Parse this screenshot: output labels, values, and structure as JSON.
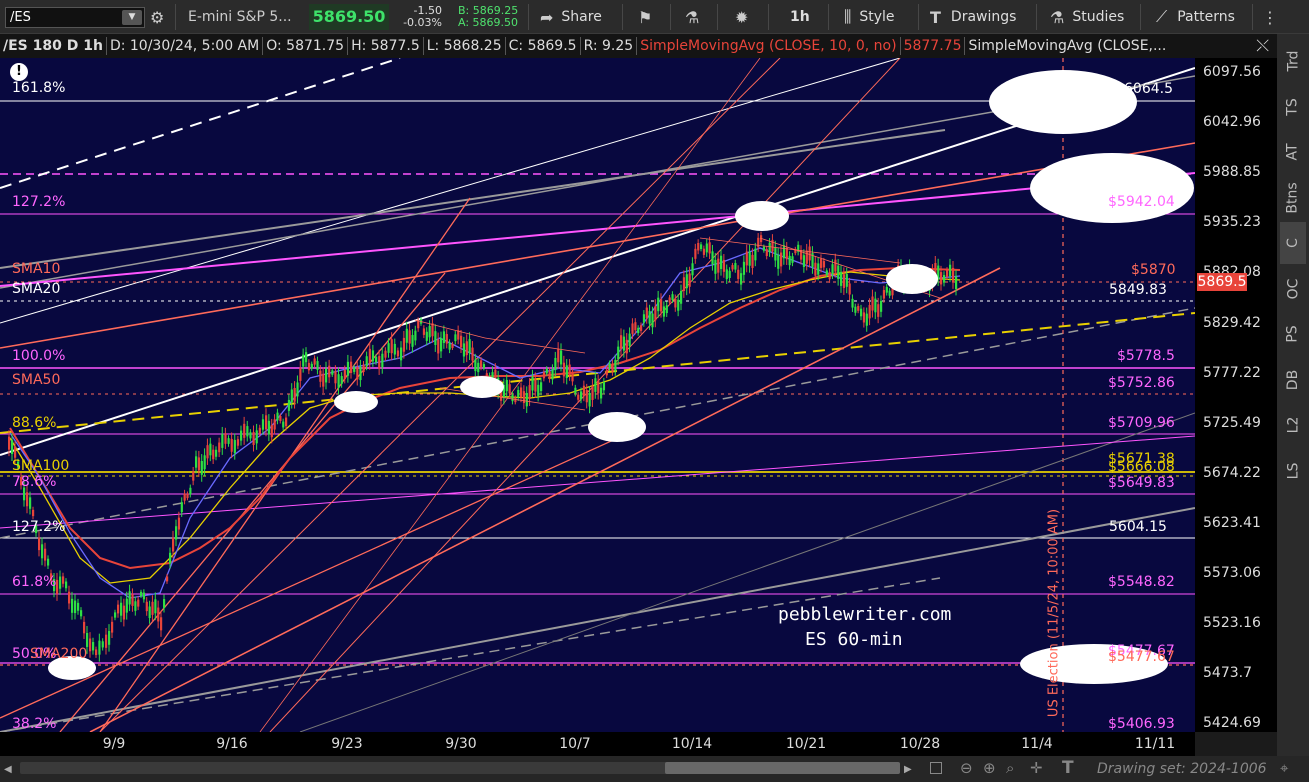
{
  "toolbar": {
    "symbol": "/ES",
    "description": "E-mini S&P 5...",
    "last": "5869.50",
    "change": "-1.50",
    "change_pct": "-0.03%",
    "bid": "B: 5869.25",
    "ask": "A: 5869.50",
    "share": "Share",
    "timeframe": "1h",
    "style": "Style",
    "drawings": "Drawings",
    "studies": "Studies",
    "patterns": "Patterns",
    "icons": [
      "dropdown-icon",
      "sliders-icon",
      "share-icon",
      "flask-icon",
      "gear-icon",
      "candlestick-icon",
      "pencil-icon",
      "beaker-icon",
      "trend-icon",
      "more-icon"
    ]
  },
  "header": {
    "title": "/ES 180 D 1h",
    "date": "D: 10/30/24, 5:00 AM",
    "open": "O: 5871.75",
    "high": "H: 5877.5",
    "low": "L: 5868.25",
    "close": "C: 5869.5",
    "range": "R: 9.25",
    "sma10_label": "SimpleMovingAvg (CLOSE, 10, 0, no)",
    "sma10_value": "5877.75",
    "sma20_label": "SimpleMovingAvg (CLOSE,..."
  },
  "price_axis": {
    "ticks": [
      "6097.56",
      "6042.96",
      "5988.85",
      "5935.23",
      "5882.08",
      "5829.42",
      "5777.22",
      "5725.49",
      "5674.22",
      "5623.41",
      "5573.06",
      "5523.16",
      "5473.7",
      "5424.69"
    ],
    "current_price": "5869.5",
    "current_color": "#e8443a"
  },
  "time_axis": {
    "ticks": [
      "9/9",
      "9/16",
      "9/23",
      "9/30",
      "10/7",
      "10/14",
      "10/21",
      "10/28",
      "11/4",
      "11/11"
    ]
  },
  "levels": {
    "fib_left": [
      "161.8%",
      "127.2%",
      "100.0%",
      "88.6%",
      "78.6%",
      "127.2%",
      "61.8%",
      "50.0%",
      "38.2%"
    ],
    "sma_left": [
      "SMA10",
      "SMA20",
      "SMA50",
      "SMA100",
      "SMA200"
    ],
    "right_labels": [
      "6064.5",
      "$5942.04",
      "$5870",
      "5849.83",
      "$5778.5",
      "$5752.86",
      "$5709.96",
      "$5671.38",
      "$5666.08",
      "$5649.83",
      "5604.15",
      "$5548.82",
      "$5477.67",
      "$5477.67",
      "$5406.93"
    ]
  },
  "annotations": {
    "watermark_line1": "pebblewriter.com",
    "watermark_line2": "ES  60-min",
    "election_label": "US Election (11/5/24, 10:00 AM)"
  },
  "right_tabs": [
    "Trd",
    "TS",
    "AT",
    "Btns",
    "C",
    "OC",
    "PS",
    "DB",
    "L2",
    "LS"
  ],
  "bottom": {
    "drawing_set": "Drawing set: 2024-1006"
  },
  "colors": {
    "background": "#08083f",
    "candle_up": "#2ee043",
    "candle_down": "#e8443a",
    "magenta": "#ff55ff",
    "salmon": "#ff6a5a",
    "yellow": "#e8d000"
  }
}
